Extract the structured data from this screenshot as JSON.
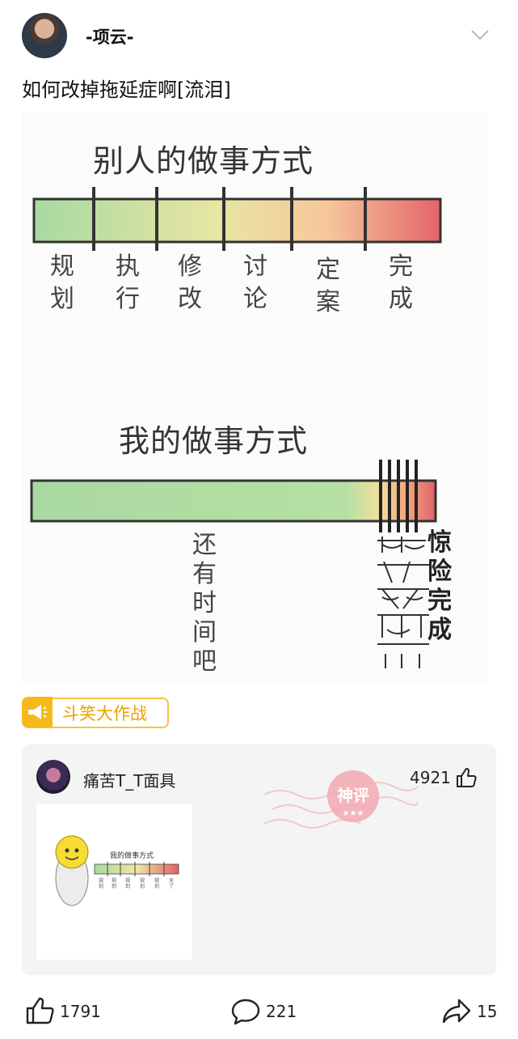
{
  "post": {
    "author": "-项云-",
    "text": "如何改掉拖延症啊[流泪]",
    "tag": "斗笑大作战"
  },
  "meme": {
    "others_title": "别人的做事方式",
    "others_stages": [
      {
        "top": "规",
        "bottom": "划"
      },
      {
        "top": "执",
        "bottom": "行"
      },
      {
        "top": "修",
        "bottom": "改"
      },
      {
        "top": "讨",
        "bottom": "论"
      },
      {
        "top": "定",
        "bottom": "案"
      },
      {
        "top": "完",
        "bottom": "成"
      }
    ],
    "mine_title": "我的做事方式",
    "mine_relaxed": [
      "还",
      "有",
      "时",
      "间",
      "吧"
    ],
    "mine_panic": [
      "惊",
      "险",
      "完",
      "成"
    ]
  },
  "god_comment": {
    "username": "痛苦T_T面具",
    "likes": "4921",
    "stamp": "神评",
    "image": {
      "title": "我的做事方式",
      "stages": [
        {
          "top": "规",
          "bottom": "划"
        },
        {
          "top": "规",
          "bottom": "划"
        },
        {
          "top": "规",
          "bottom": "划"
        },
        {
          "top": "规",
          "bottom": "划"
        },
        {
          "top": "规",
          "bottom": "划"
        },
        {
          "top": "无",
          "bottom": "了"
        }
      ]
    }
  },
  "footer": {
    "likes": "1791",
    "comments": "221",
    "shares": "15"
  },
  "colors": {
    "accent": "#f6b91b",
    "bar_green": "#a8d8a0",
    "bar_red": "#e26a66"
  }
}
